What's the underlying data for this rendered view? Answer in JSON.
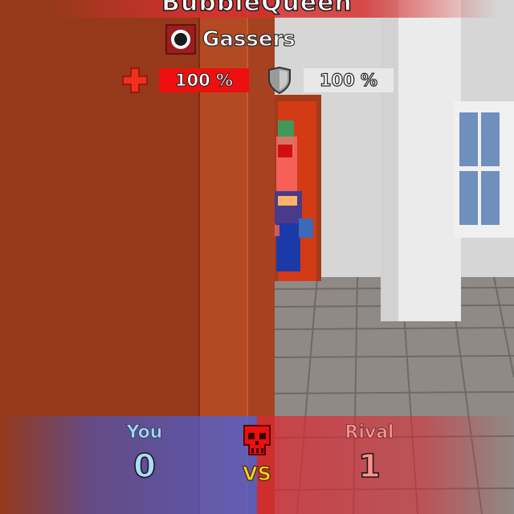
{
  "target": {
    "player_name": "BubbleQueen",
    "clan_name": "Gassers",
    "clan_emblem_icon": "pinwheel-emblem-icon",
    "health_icon": "red-cross-icon",
    "health_value": "100 %",
    "armor_icon": "shield-icon",
    "armor_value": "100 %"
  },
  "score": {
    "you_label": "You",
    "you_value": "0",
    "rival_label": "Rival",
    "rival_value": "1",
    "vs_label": "VS",
    "center_icon": "red-skull-icon"
  },
  "colors": {
    "team_blue": "#4a6ee0",
    "team_red": "#dc2832",
    "health_red": "#ee1010",
    "vs_yellow": "#ffd21a"
  }
}
